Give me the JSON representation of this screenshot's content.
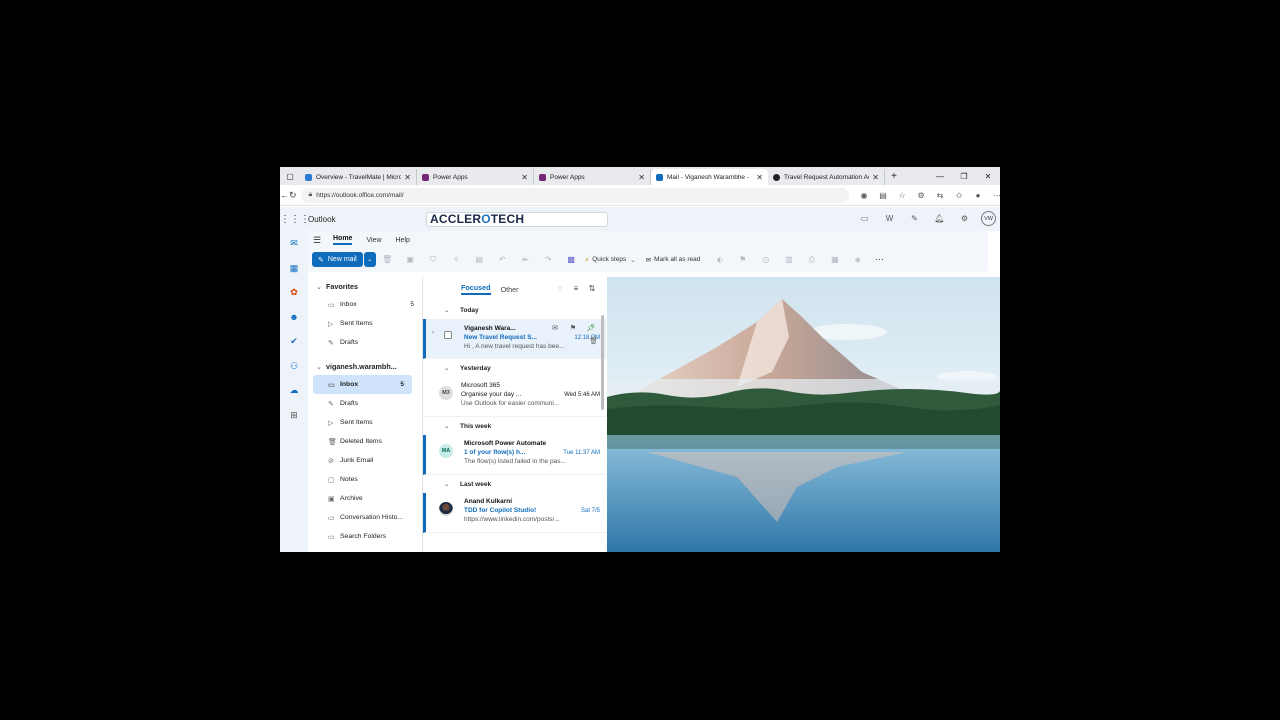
{
  "browser": {
    "tabs": [
      {
        "title": "Overview - TravelMate | Micro",
        "icon_color": "#2b7cd3",
        "active": false
      },
      {
        "title": "Power Apps",
        "icon_color": "#742774",
        "active": false
      },
      {
        "title": "Power Apps",
        "icon_color": "#742774",
        "active": false
      },
      {
        "title": "Mail - Viganesh Warambhe -",
        "icon_color": "#0f6cbd",
        "active": true
      },
      {
        "title": "Travel Request Automation Ac",
        "icon_color": "#222222",
        "active": false
      }
    ],
    "url": "https://outlook.office.com/mail/"
  },
  "outlook": {
    "app_name": "Outlook",
    "brand_logo": "ACCLEROTECH",
    "avatar_initials": "VW",
    "ribbon_tabs": [
      "Home",
      "View",
      "Help"
    ],
    "new_mail_label": "New mail",
    "quick_steps_label": "Quick steps",
    "mark_all_read_label": "Mark all as read"
  },
  "folders": {
    "favorites_label": "Favorites",
    "favorites": [
      {
        "label": "Inbox",
        "count": "5",
        "icon": "inbox-icon"
      },
      {
        "label": "Sent Items",
        "count": "",
        "icon": "send-icon"
      },
      {
        "label": "Drafts",
        "count": "",
        "icon": "draft-icon"
      }
    ],
    "account_label": "viganesh.warambh...",
    "account_folders": [
      {
        "label": "Inbox",
        "count": "5",
        "icon": "inbox-icon",
        "selected": true
      },
      {
        "label": "Drafts",
        "count": "",
        "icon": "draft-icon"
      },
      {
        "label": "Sent Items",
        "count": "",
        "icon": "send-icon"
      },
      {
        "label": "Deleted Items",
        "count": "",
        "icon": "trash-icon"
      },
      {
        "label": "Junk Email",
        "count": "",
        "icon": "junk-icon"
      },
      {
        "label": "Notes",
        "count": "",
        "icon": "notes-icon"
      },
      {
        "label": "Archive",
        "count": "",
        "icon": "archive-icon"
      },
      {
        "label": "Conversation Histo...",
        "count": "",
        "icon": "folder-icon"
      },
      {
        "label": "Search Folders",
        "count": "",
        "icon": "folder-icon"
      }
    ]
  },
  "message_list": {
    "tabs": [
      "Focused",
      "Other"
    ],
    "groups": {
      "today": "Today",
      "yesterday": "Yesterday",
      "this_week": "This week",
      "last_week": "Last week"
    },
    "messages": [
      {
        "sender": "Viganesh Wara...",
        "subject": "New Travel Request S...",
        "time": "12:18 PM",
        "preview": "Hi , A new travel request has bee...",
        "avatar": "",
        "avatar_color": "",
        "unread": true
      },
      {
        "sender": "Microsoft 365",
        "subject": "Organise your day ...",
        "time": "Wed 5:46 AM",
        "preview": "Use Outlook for easier communi...",
        "avatar": "M3",
        "avatar_color": "#e1dfdd",
        "unread": false
      },
      {
        "sender": "Microsoft Power Automate",
        "subject": "1 of your flow(s) h...",
        "time": "Tue 11:37 AM",
        "preview": "The flow(s) listed failed in the pas...",
        "avatar": "MA",
        "avatar_color": "#c7ece8",
        "unread": true
      },
      {
        "sender": "Anand Kulkarni",
        "subject": "TDD for Copilot Studio!",
        "time": "Sat 7/5",
        "preview": "https://www.linkedin.com/posts/...",
        "avatar": "",
        "avatar_color": "#8a5a44",
        "unread": true
      }
    ]
  },
  "colors": {
    "accent": "#0f6cbd",
    "selected_folder": "#cfe4fa"
  }
}
